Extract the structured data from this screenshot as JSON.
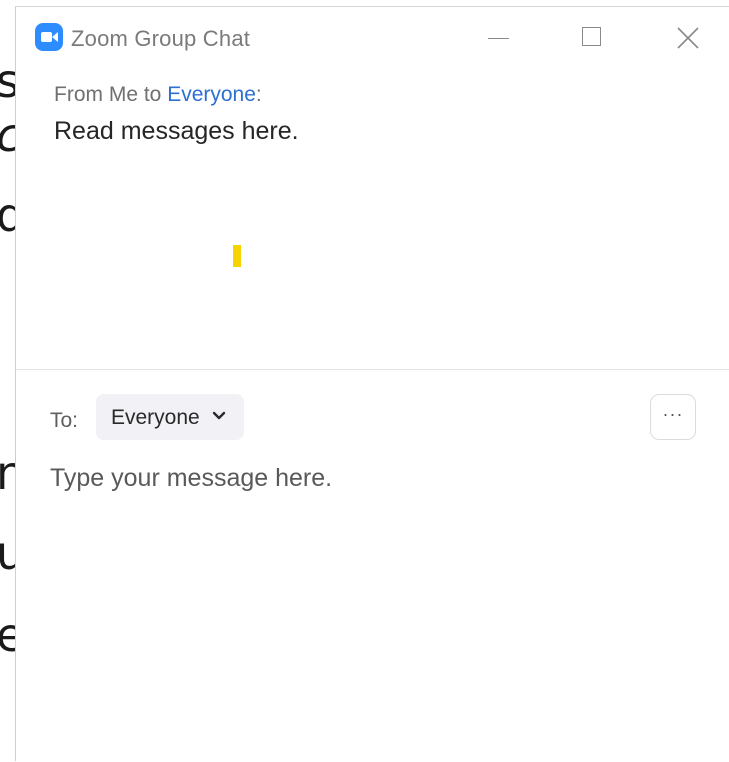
{
  "background": {
    "lines": [
      "s",
      "c",
      "d",
      "n",
      "u",
      "e"
    ]
  },
  "window": {
    "title": "Zoom Group Chat",
    "app_icon": "zoom-camera-icon",
    "controls": [
      "minimize-icon",
      "maximize-icon",
      "close-icon"
    ]
  },
  "message": {
    "from_prefix": "From Me to ",
    "recipient": "Everyone",
    "suffix": ":",
    "body": "Read messages here."
  },
  "compose": {
    "to_label": "To:",
    "selected_recipient": "Everyone",
    "more_label": "···",
    "placeholder": "Type your message here."
  },
  "colors": {
    "brand": "#2d8cff",
    "recipient_link": "#2d6fd1",
    "cursor_highlight": "#f5d400"
  }
}
